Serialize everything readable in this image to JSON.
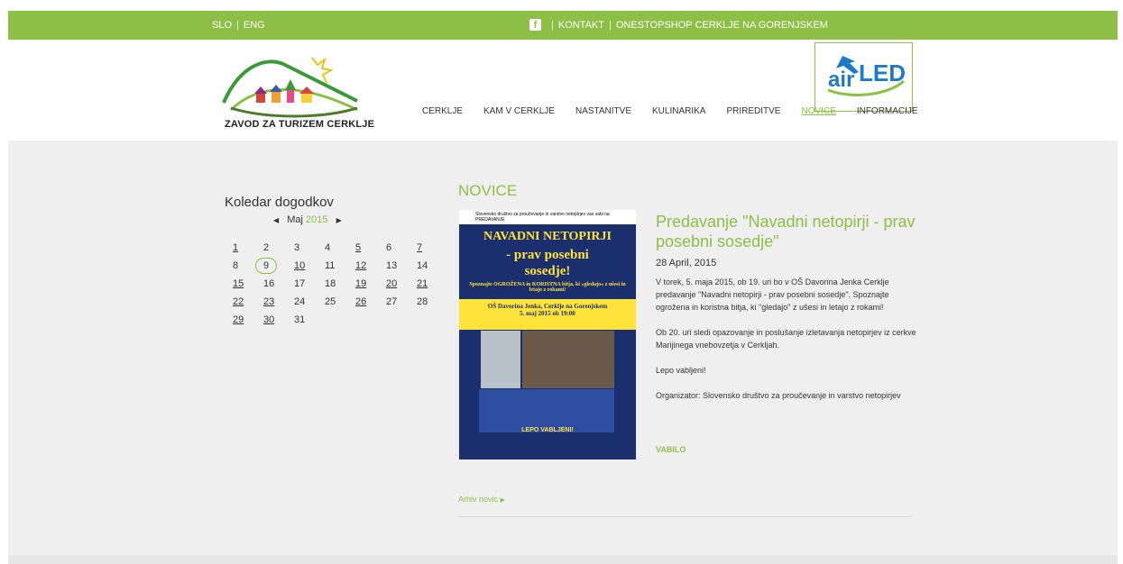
{
  "topbar": {
    "lang_slo": "SLO",
    "lang_sep": "|",
    "lang_eng": "ENG",
    "fb_icon": "facebook-icon",
    "contact": "KONTAKT",
    "onestop": "ONESTOPSHOP CERKLJE NA GORENJSKEM",
    "sep": "|"
  },
  "header": {
    "logo_text": "ZAVOD ZA TURIZEM CERKLJE",
    "airled": "airLED",
    "nav": [
      "CERKLJE",
      "KAM V CERKLJE",
      "NASTANITVE",
      "KULINARIKA",
      "PRIREDITVE",
      "NOVICE",
      "INFORMACIJE"
    ],
    "active_nav": "NOVICE"
  },
  "calendar": {
    "title": "Koledar dogodkov",
    "month": "Maj",
    "year": "2015",
    "rows": [
      [
        "1",
        "2",
        "3",
        "4",
        "5",
        "6",
        "7"
      ],
      [
        "8",
        "9",
        "10",
        "11",
        "12",
        "13",
        "14"
      ],
      [
        "15",
        "16",
        "17",
        "18",
        "19",
        "20",
        "21"
      ],
      [
        "22",
        "23",
        "24",
        "25",
        "26",
        "27",
        "28"
      ],
      [
        "29",
        "30",
        "31",
        "",
        "",
        "",
        ""
      ]
    ],
    "event_days": [
      "1",
      "5",
      "7",
      "10",
      "12",
      "15",
      "19",
      "20",
      "21",
      "22",
      "23",
      "26",
      "29",
      "30"
    ],
    "today": "9"
  },
  "news": {
    "section_title": "NOVICE",
    "poster": {
      "org": "Slovensko društvo za proučevanje in varstvo netopirjev vas vabi na PREDAVANJE",
      "headline1": "NAVADNI NETOPIRJI",
      "headline2": "- prav posebni",
      "headline3": "sosedje!",
      "sub": "Spoznajte OGROŽENA in KORISTNA bitja, ki »gledajo« z ušesi in letajo z rokami!",
      "place": "OŠ Davorina Jenka, Cerklje na Gorenjskem",
      "when": "5. maj 2015 ob 19:00",
      "closing": "LEPO VABLJENI!"
    },
    "article_title": "Predavanje \"Navadni netopirji - prav posebni sosedje\"",
    "date": "28 April, 2015",
    "paragraphs": [
      "V torek, 5. maja 2015, ob 19. uri bo v OŠ Davorina Jenka Cerklje predavanje \"Navadni netopirji - prav posebni sosedje\". Spoznajte ogrožena in koristna bitja, ki \"gledajo\" z ušesi in letajo z rokami!",
      "Ob 20. uri sledi opazovanje in poslušanje izletavanja netopirjev iz cerkve Marijinega vnebovzetja v Cerkljah.",
      "Lepo vabljeni!",
      "Organizator: Slovensko društvo za proučevanje in varstvo netopirjev"
    ],
    "attachment": "VABILO",
    "archive": "Arhiv novic"
  },
  "colors": {
    "accent": "#8dbf47",
    "background": "#efefef",
    "poster_blue": "#1b2f6e",
    "poster_yellow": "#ffe23a"
  }
}
